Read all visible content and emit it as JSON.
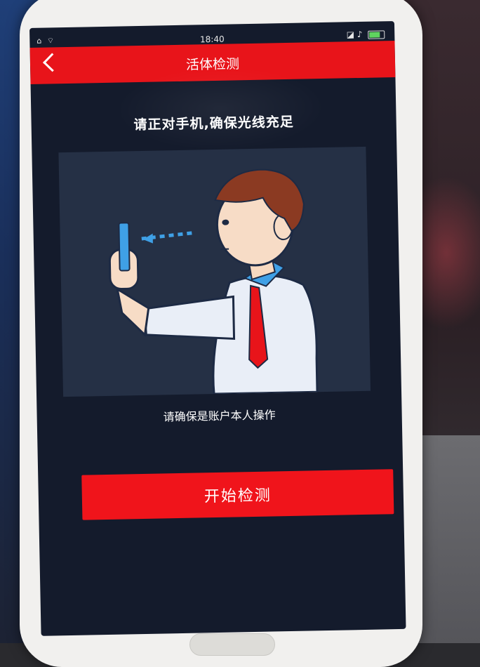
{
  "status_bar": {
    "time": "18:40",
    "left_icons": "⌂ ⌔",
    "right_icons": "◪ ♪"
  },
  "nav": {
    "title": "活体检测",
    "back_icon": "chevron-left-icon"
  },
  "content": {
    "instruction": "请正对手机,确保光线充足",
    "caption": "请确保是账户本人操作"
  },
  "actions": {
    "start_label": "开始检测"
  },
  "colors": {
    "accent": "#e8141a",
    "screen_bg": "#141b2c",
    "illustration_bg": "#253045"
  }
}
